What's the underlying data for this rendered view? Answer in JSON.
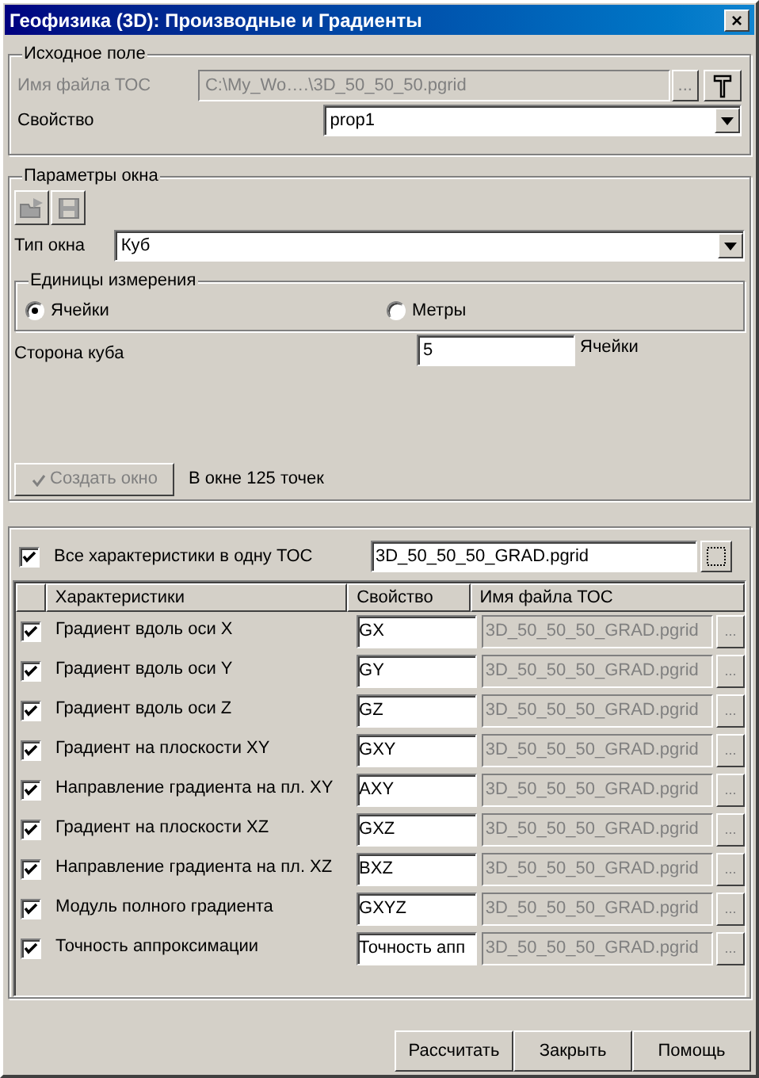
{
  "window": {
    "title": "Геофизика (3D): Производные и Градиенты",
    "close": "×"
  },
  "source": {
    "legend": "Исходное поле",
    "file_label": "Имя файла ТОС",
    "file_value": "C:\\My_Wo….\\3D_50_50_50.pgrid",
    "browse": "...",
    "property_label": "Свойство",
    "property_value": "prop1"
  },
  "params": {
    "legend": "Параметры окна",
    "type_label": "Тип окна",
    "type_value": "Куб",
    "units": {
      "legend": "Единицы измерения",
      "options": [
        {
          "label": "Ячейки",
          "selected": true
        },
        {
          "label": "Метры",
          "selected": false
        }
      ]
    },
    "side_label": "Сторона куба",
    "side_value": "5",
    "side_unit": "Ячейки",
    "create_button": {
      "label": "Создать окно",
      "disabled": true
    },
    "points_text": "В окне 125 точек"
  },
  "output": {
    "all_in_one": {
      "label": "Все характеристики в одну ТОС",
      "checked": true,
      "value": "3D_50_50_50_GRAD.pgrid"
    },
    "columns": [
      "Характеристики",
      "Свойство",
      "Имя файла ТОС"
    ],
    "rows": [
      {
        "checked": true,
        "name": "Градиент вдоль оси X",
        "property": "GX",
        "file": "3D_50_50_50_GRAD.pgrid",
        "browse": "..."
      },
      {
        "checked": true,
        "name": "Градиент вдоль оси Y",
        "property": "GY",
        "file": "3D_50_50_50_GRAD.pgrid",
        "browse": "..."
      },
      {
        "checked": true,
        "name": "Градиент вдоль оси Z",
        "property": "GZ",
        "file": "3D_50_50_50_GRAD.pgrid",
        "browse": "..."
      },
      {
        "checked": true,
        "name": "Градиент на плоскости XY",
        "property": "GXY",
        "file": "3D_50_50_50_GRAD.pgrid",
        "browse": "..."
      },
      {
        "checked": true,
        "name": "Направление градиента на пл. XY",
        "property": "AXY",
        "file": "3D_50_50_50_GRAD.pgrid",
        "browse": "..."
      },
      {
        "checked": true,
        "name": "Градиент на плоскости XZ",
        "property": "GXZ",
        "file": "3D_50_50_50_GRAD.pgrid",
        "browse": "..."
      },
      {
        "checked": true,
        "name": "Направление градиента на пл. XZ",
        "property": "BXZ",
        "file": "3D_50_50_50_GRAD.pgrid",
        "browse": "..."
      },
      {
        "checked": true,
        "name": "Модуль полного градиента",
        "property": "GXYZ",
        "file": "3D_50_50_50_GRAD.pgrid",
        "browse": "..."
      },
      {
        "checked": true,
        "name": "Точность аппроксимации",
        "property": "Точность апп",
        "file": "3D_50_50_50_GRAD.pgrid",
        "browse": "..."
      }
    ]
  },
  "buttons": [
    "Рассчитать",
    "Закрыть",
    "Помощь"
  ]
}
